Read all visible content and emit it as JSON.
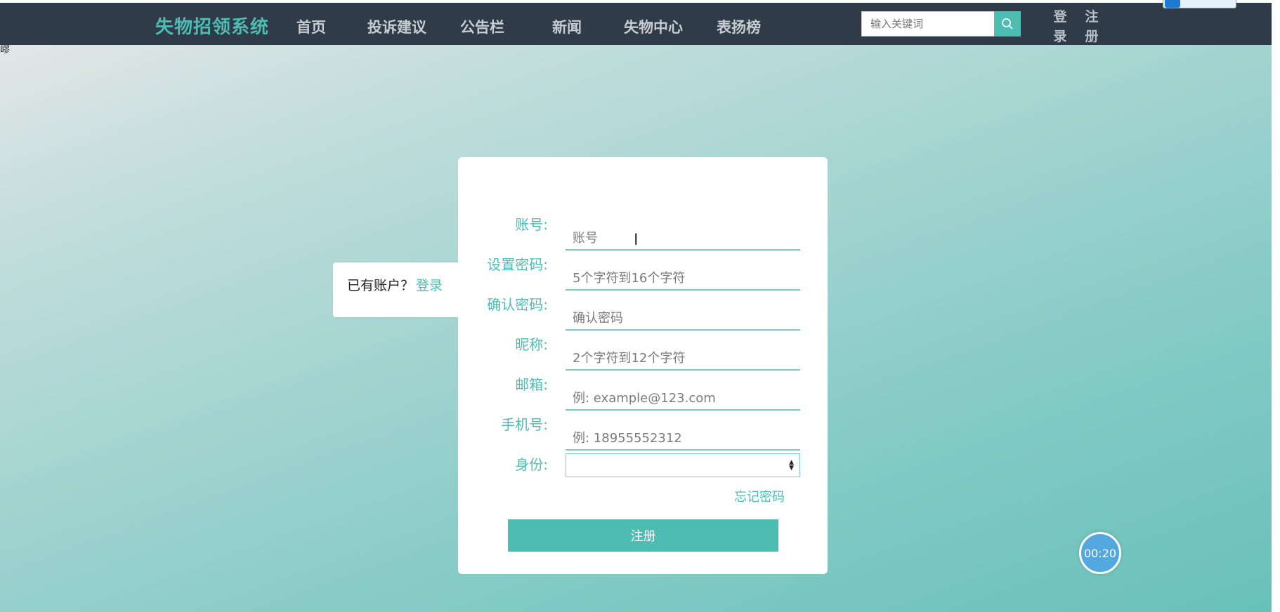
{
  "brand": "失物招领系统",
  "nav": {
    "items": [
      "首页",
      "投诉建议",
      "公告栏",
      "新闻",
      "失物中心",
      "表扬榜"
    ],
    "search_placeholder": "输入关键词",
    "login_top": "登",
    "login_bottom": "录",
    "register_top": "注",
    "register_bottom": "册"
  },
  "stray_char": "嵺",
  "side_tab": {
    "question": "已有账户？",
    "login_link": "登录"
  },
  "form": {
    "fields": [
      {
        "label": "账号:",
        "placeholder": "账号"
      },
      {
        "label": "设置密码:",
        "placeholder": "5个字符到16个字符"
      },
      {
        "label": "确认密码:",
        "placeholder": "确认密码"
      },
      {
        "label": "昵称:",
        "placeholder": "2个字符到12个字符"
      },
      {
        "label": "邮箱:",
        "placeholder": "例: example@123.com"
      },
      {
        "label": "手机号:",
        "placeholder": "例: 18955552312"
      }
    ],
    "identity_label": "身份:",
    "identity_value": "",
    "forgot_password": "忘记密码",
    "submit_label": "注册"
  },
  "timer": "00:20",
  "colors": {
    "accent": "#4dbdb4",
    "navbar": "#2f3b48",
    "timer": "#53a8df"
  },
  "icons": [
    "search-icon",
    "select-arrows-icon",
    "text-cursor-icon"
  ]
}
